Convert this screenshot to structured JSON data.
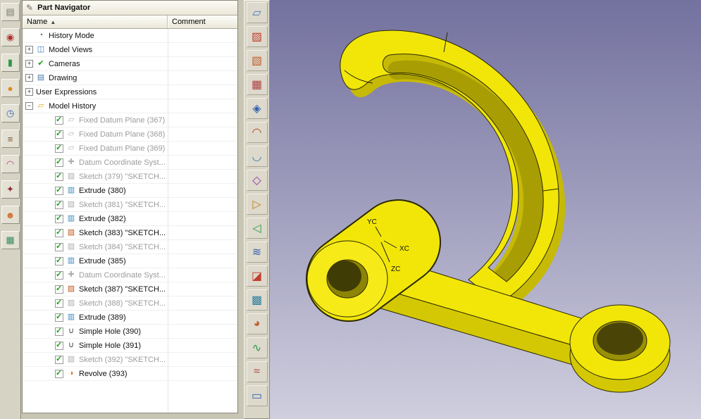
{
  "navigator": {
    "title": "Part Navigator",
    "columns": {
      "name": "Name",
      "sort_indicator": "▲",
      "comment": "Comment"
    },
    "tree": [
      {
        "label": "History Mode",
        "icon": "history-mode",
        "level": 0,
        "expander": "none",
        "checkbox": false,
        "grayed": false
      },
      {
        "label": "Model Views",
        "icon": "model-views",
        "level": 0,
        "expander": "plus",
        "checkbox": false,
        "grayed": false
      },
      {
        "label": "Cameras",
        "icon": "cameras",
        "level": 0,
        "expander": "plus",
        "checkbox": false,
        "grayed": false
      },
      {
        "label": "Drawing",
        "icon": "drawing",
        "level": 0,
        "expander": "plus",
        "checkbox": false,
        "grayed": false
      },
      {
        "label": "User Expressions",
        "icon": "none",
        "level": 0,
        "expander": "plus",
        "checkbox": false,
        "grayed": false
      },
      {
        "label": "Model History",
        "icon": "folder-open",
        "level": 0,
        "expander": "minus",
        "checkbox": false,
        "grayed": false
      },
      {
        "label": "Fixed Datum Plane (367)",
        "icon": "datum-plane",
        "level": 1,
        "expander": "none",
        "checkbox": true,
        "grayed": true
      },
      {
        "label": "Fixed Datum Plane (368)",
        "icon": "datum-plane",
        "level": 1,
        "expander": "none",
        "checkbox": true,
        "grayed": true
      },
      {
        "label": "Fixed Datum Plane (369)",
        "icon": "datum-plane",
        "level": 1,
        "expander": "none",
        "checkbox": true,
        "grayed": true
      },
      {
        "label": "Datum Coordinate Syst...",
        "icon": "coord-sys",
        "level": 1,
        "expander": "none",
        "checkbox": true,
        "grayed": true
      },
      {
        "label": "Sketch (379) \"SKETCH...",
        "icon": "sketch",
        "level": 1,
        "expander": "none",
        "checkbox": true,
        "grayed": true
      },
      {
        "label": "Extrude (380)",
        "icon": "extrude",
        "level": 1,
        "expander": "none",
        "checkbox": true,
        "grayed": false
      },
      {
        "label": "Sketch (381) \"SKETCH...",
        "icon": "sketch",
        "level": 1,
        "expander": "none",
        "checkbox": true,
        "grayed": true
      },
      {
        "label": "Extrude (382)",
        "icon": "extrude",
        "level": 1,
        "expander": "none",
        "checkbox": true,
        "grayed": false
      },
      {
        "label": "Sketch (383) \"SKETCH...",
        "icon": "sketch",
        "level": 1,
        "expander": "none",
        "checkbox": true,
        "grayed": false
      },
      {
        "label": "Sketch (384) \"SKETCH...",
        "icon": "sketch",
        "level": 1,
        "expander": "none",
        "checkbox": true,
        "grayed": true
      },
      {
        "label": "Extrude (385)",
        "icon": "extrude",
        "level": 1,
        "expander": "none",
        "checkbox": true,
        "grayed": false
      },
      {
        "label": "Datum Coordinate Syst...",
        "icon": "coord-sys",
        "level": 1,
        "expander": "none",
        "checkbox": true,
        "grayed": true
      },
      {
        "label": "Sketch (387) \"SKETCH...",
        "icon": "sketch",
        "level": 1,
        "expander": "none",
        "checkbox": true,
        "grayed": false
      },
      {
        "label": "Sketch (388) \"SKETCH...",
        "icon": "sketch",
        "level": 1,
        "expander": "none",
        "checkbox": true,
        "grayed": true
      },
      {
        "label": "Extrude (389)",
        "icon": "extrude",
        "level": 1,
        "expander": "none",
        "checkbox": true,
        "grayed": false
      },
      {
        "label": "Simple Hole (390)",
        "icon": "simple-hole",
        "level": 1,
        "expander": "none",
        "checkbox": true,
        "grayed": false
      },
      {
        "label": "Simple Hole (391)",
        "icon": "simple-hole",
        "level": 1,
        "expander": "none",
        "checkbox": true,
        "grayed": false
      },
      {
        "label": "Sketch (392) \"SKETCH...",
        "icon": "sketch",
        "level": 1,
        "expander": "none",
        "checkbox": true,
        "grayed": true
      },
      {
        "label": "Revolve (393)",
        "icon": "revolve",
        "level": 1,
        "expander": "none",
        "checkbox": true,
        "grayed": false
      }
    ]
  },
  "icon_glyphs": {
    "history-mode": {
      "glyph": "◔",
      "color": "#4a6a8a"
    },
    "model-views": {
      "glyph": "◫",
      "color": "#3a7abf"
    },
    "cameras": {
      "glyph": "✔",
      "color": "#1ca01c"
    },
    "drawing": {
      "glyph": "▤",
      "color": "#4a7ab0"
    },
    "folder-open": {
      "glyph": "▱",
      "color": "#d8a020"
    },
    "datum-plane": {
      "glyph": "▱",
      "color": "#9aa0a8"
    },
    "coord-sys": {
      "glyph": "✚",
      "color": "#2aa0b8"
    },
    "sketch": {
      "glyph": "▨",
      "color": "#c05a20"
    },
    "extrude": {
      "glyph": "▥",
      "color": "#3a8ac0"
    },
    "simple-hole": {
      "glyph": "∪",
      "color": "#404040"
    },
    "revolve": {
      "glyph": "◑",
      "color": "#e07820"
    }
  },
  "glyphs": {
    "check": "✓",
    "plus": "+",
    "minus": "−",
    "header_icon": "✎"
  },
  "resource_bar": {
    "items": [
      {
        "name": "tabbed-panel-icon",
        "glyph": "▤",
        "color": "#7a7a6a"
      },
      {
        "name": "measurement-icon",
        "glyph": "◉",
        "color": "#b03030"
      },
      {
        "name": "thermometer-icon",
        "glyph": "▮",
        "color": "#2a9a4a"
      },
      {
        "name": "sphere-icon",
        "glyph": "●",
        "color": "#e08820"
      },
      {
        "name": "history-clock-icon",
        "glyph": "◷",
        "color": "#3a6ab0"
      },
      {
        "name": "notes-icon",
        "glyph": "≡",
        "color": "#7a5a30"
      },
      {
        "name": "palette-rainbow-icon",
        "glyph": "◠",
        "color": "#c04080"
      },
      {
        "name": "tools-icon",
        "glyph": "✦",
        "color": "#8a3030"
      },
      {
        "name": "roles-icon",
        "glyph": "☻",
        "color": "#d07030"
      },
      {
        "name": "gallery-icon",
        "glyph": "▦",
        "color": "#3a8a5a"
      }
    ]
  },
  "surface_toolbar": {
    "items": [
      {
        "name": "bounded-plane-icon",
        "glyph": "▱",
        "color": "#4a7ac0"
      },
      {
        "name": "ruled-surface-icon",
        "glyph": "▨",
        "color": "#c04030"
      },
      {
        "name": "through-curves-icon",
        "glyph": "▧",
        "color": "#c06030"
      },
      {
        "name": "through-curve-mesh-icon",
        "glyph": "▦",
        "color": "#b04040"
      },
      {
        "name": "studio-surface-icon",
        "glyph": "◈",
        "color": "#3060b0"
      },
      {
        "name": "swept-surface-icon",
        "glyph": "◠",
        "color": "#b05020"
      },
      {
        "name": "section-surface-icon",
        "glyph": "◡",
        "color": "#3080a0"
      },
      {
        "name": "n-sided-surface-icon",
        "glyph": "◇",
        "color": "#9030a0"
      },
      {
        "name": "extension-icon",
        "glyph": "▷",
        "color": "#c08020"
      },
      {
        "name": "law-extension-icon",
        "glyph": "◁",
        "color": "#2a9a4a"
      },
      {
        "name": "offset-surface-icon",
        "glyph": "≋",
        "color": "#3060b0"
      },
      {
        "name": "trimmed-sheet-icon",
        "glyph": "◪",
        "color": "#c04030"
      },
      {
        "name": "fill-surface-icon",
        "glyph": "▩",
        "color": "#3080a0"
      },
      {
        "name": "face-blend-icon",
        "glyph": "◕",
        "color": "#c06030"
      },
      {
        "name": "soft-blend-icon",
        "glyph": "∿",
        "color": "#2a9a4a"
      },
      {
        "name": "styled-blend-icon",
        "glyph": "≈",
        "color": "#b04040"
      },
      {
        "name": "global-shaping-icon",
        "glyph": "▭",
        "color": "#3060b0"
      }
    ]
  },
  "viewport": {
    "background_top": "#73719e",
    "background_bottom": "#cfcede",
    "part_color": "#f2e609",
    "axis_labels": {
      "x": "XC",
      "y": "YC",
      "z": "ZC"
    }
  }
}
